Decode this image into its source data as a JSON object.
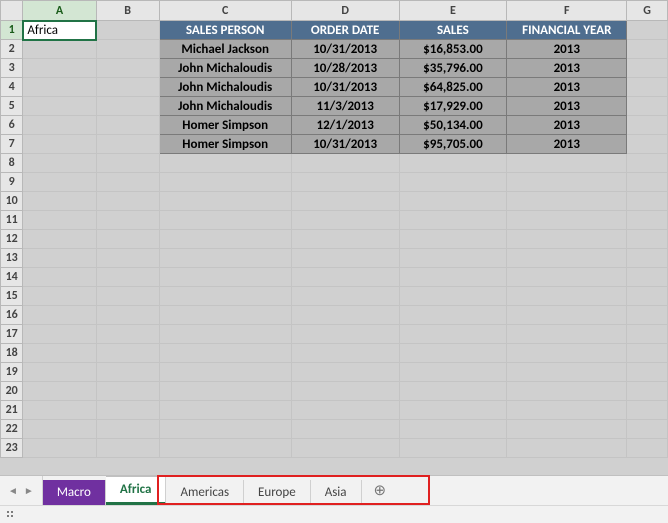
{
  "columns": [
    "A",
    "B",
    "C",
    "D",
    "E",
    "F",
    "G"
  ],
  "row_count": 23,
  "active_cell": {
    "row": 1,
    "col": "A",
    "value": "Africa"
  },
  "table": {
    "headers": [
      "SALES PERSON",
      "ORDER DATE",
      "SALES",
      "FINANCIAL YEAR"
    ],
    "rows": [
      {
        "person": "Michael Jackson",
        "date": "10/31/2013",
        "sales": "$16,853.00",
        "year": "2013"
      },
      {
        "person": "John Michaloudis",
        "date": "10/28/2013",
        "sales": "$35,796.00",
        "year": "2013"
      },
      {
        "person": "John Michaloudis",
        "date": "10/31/2013",
        "sales": "$64,825.00",
        "year": "2013"
      },
      {
        "person": "John Michaloudis",
        "date": "11/3/2013",
        "sales": "$17,929.00",
        "year": "2013"
      },
      {
        "person": "Homer Simpson",
        "date": "12/1/2013",
        "sales": "$50,134.00",
        "year": "2013"
      },
      {
        "person": "Homer Simpson",
        "date": "10/31/2013",
        "sales": "$95,705.00",
        "year": "2013"
      }
    ]
  },
  "tabs": [
    {
      "label": "Macro",
      "kind": "macro"
    },
    {
      "label": "Africa",
      "kind": "active"
    },
    {
      "label": "Americas",
      "kind": "normal"
    },
    {
      "label": "Europe",
      "kind": "normal"
    },
    {
      "label": "Asia",
      "kind": "normal"
    }
  ],
  "nav": {
    "prev": "◄",
    "next": "►"
  },
  "add_sheet_icon": "⊕"
}
